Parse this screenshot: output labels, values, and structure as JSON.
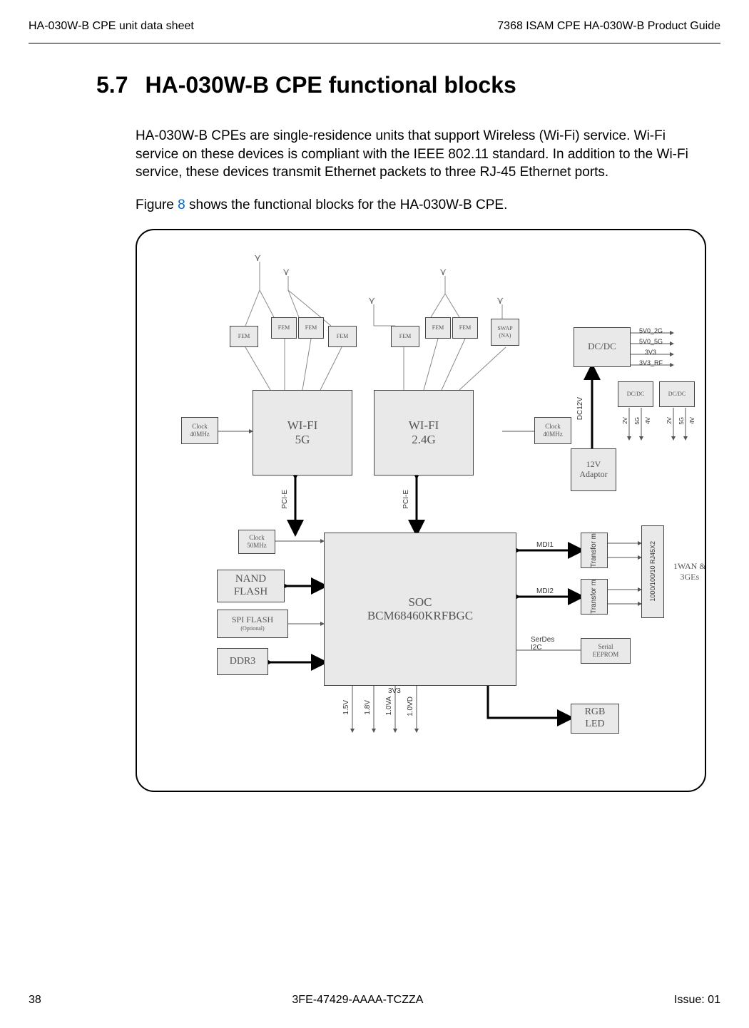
{
  "header": {
    "left": "HA-030W-B CPE unit data sheet",
    "right": "7368 ISAM CPE HA-030W-B Product Guide"
  },
  "section": {
    "num": "5.7",
    "title": "HA-030W-B CPE functional blocks"
  },
  "paragraphs": {
    "p1": "HA-030W-B CPEs are single-residence units that support Wireless (Wi-Fi) service. Wi-Fi service on these devices is compliant with the IEEE 802.11 standard. In addition to the Wi-Fi service, these devices transmit Ethernet packets to three RJ-45 Ethernet ports.",
    "p2a": "Figure ",
    "p2_fig": "8",
    "p2b": " shows the functional blocks for the HA-030W-B CPE."
  },
  "diagram": {
    "fem1": "FEM",
    "fem2": "FEM",
    "fem3": "FEM",
    "fem4": "FEM",
    "fem5": "FEM",
    "fem6": "FEM",
    "fem7": "FEM",
    "swap": "SWAP\n(NA)",
    "clk40_l": "Clock\n40MHz",
    "clk40_r": "Clock\n40MHz",
    "wifi5g": "WI-FI\n5G",
    "wifi24g": "WI-FI\n2.4G",
    "dcdc1": "DC/DC",
    "dcdc2": "DC/DC",
    "dcdc3": "DC/DC",
    "adaptor": "12V\nAdaptor",
    "clk50": "Clock\n50MHz",
    "nand": "NAND\nFLASH",
    "spi": "SPI FLASH",
    "spi_opt": "(Optional)",
    "ddr3": "DDR3",
    "soc": "SOC\nBCM68460KRFBGC",
    "trans1": "Transfor\nm",
    "trans2": "Transfor\nm",
    "rj45": "1000/100/10 RJ45X2",
    "wan": "1WAN &\n3GEs",
    "eeprom": "Serial\nEEPROM",
    "rgb": "RGB\nLED",
    "pcie_l": "PCI-E",
    "pcie_r": "PCI-E",
    "mdi1": "MDI1",
    "mdi2": "MDI2",
    "serdesi2c": "SerDes\nI2C",
    "v3v3": "3V3",
    "v15": "1.5V",
    "v18": "1.8V",
    "v10va": "1.0VA",
    "v10vd": "1.0VD",
    "dc12v": "DC12V",
    "p5v2g": "5V0_2G",
    "p5v5g": "5V0_5G",
    "p3v3": "3V3",
    "p3v3rf": "3V3_RF",
    "p2v": "2V",
    "p5g": "5G",
    "p4v": "4V",
    "p5g2": "5G"
  },
  "footer": {
    "page": "38",
    "docnum": "3FE-47429-AAAA-TCZZA",
    "issue": "Issue: 01"
  }
}
